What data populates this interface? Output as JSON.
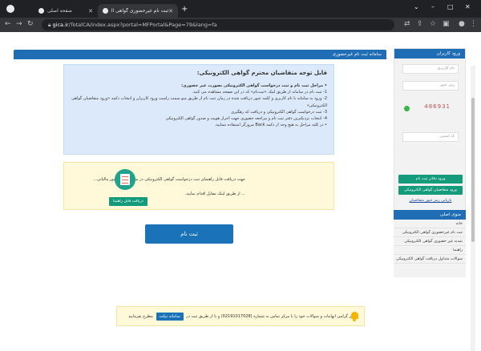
{
  "browser": {
    "tabs": [
      {
        "title": "صفحه اصلی"
      },
      {
        "title": "ثبت نام غیرحضوری گواهی الکترونیک"
      }
    ],
    "new_tab": "+",
    "url_host": "gica.ir",
    "url_path": "/TotalCA/index.aspx?portal=MFPortal&Page=79&lang=fa",
    "window_controls": {
      "minimize": "–",
      "maximize": "□",
      "close": "✕"
    }
  },
  "main": {
    "panel_title": "سامانه ثبت نام غیرحضوری",
    "notice": {
      "heading": "قابل توجه متقاضیان محترم گواهی الکترونیکی:",
      "lines": [
        "• مراحل ثبت نام و ثبت درخواست گواهی الکترونیکی بصورت غیر حضوری:",
        "1- ثبت نام در سامانه از طریق لینک «ثبت‌نام» که در این صفحه مشاهده می کنید.",
        "2- ورود به سامانه با نام کاربری و کلمه عبور دریافت شده در زمان ثبت نام از طریق منو سمت راست ورود کاربران و انتخاب دکمه «ورود متقاضیان گواهی الکترونیکی»",
        "3- ثبت درخواست گواهی الکترونیکی و دریافت کد رهگیری",
        "4- انتخاب نزدیکترین دفتر ثبت نام و مراجعه حضوری جهت احراز هویت و صدور گواهی الکترونیکی",
        "• در کلیه مراحل به هیچ وجه از دکمه Back مرورگر استفاده ننمایید."
      ]
    },
    "download": {
      "text1": "جهت دریافت فایل راهنمای ثبت درخواست گواهی الکترونیکی در سامانه ستاد امور مالیاتی...",
      "text2": "... از طریق لینک مقابل اقدام نمایید.",
      "button": "دریافت فایل راهنما"
    },
    "signup_button": "ثبت نام",
    "footer": {
      "text_before": "کاربر گرامی ابهامات و سوالات خود را با مرکز تماس به شماره (02191017028) و یا از طریق ثبت در",
      "system": "سامانه تیکت",
      "text_after": "مطرح بفرمایید"
    }
  },
  "sidebar": {
    "login_title": "ورود کاربران",
    "username_placeholder": "نام کاربری",
    "password_placeholder": "رمز عبور",
    "captcha_value": "486931",
    "captcha_placeholder": "کد امنیتی",
    "login_button": "ورود دفاتر ثبت نام",
    "applicant_button": "ورود متقاضیان گواهی الکترونیکی",
    "forgot_link": "بازیابی رمز عبور متقاضیان",
    "menu_title": "منوی اصلی",
    "menu_items": [
      "خانه",
      "ثبت نام غیرحضوری گواهی الکترونیکی",
      "تمدید غیر حضوری گواهی الکترونیکی",
      "راهنما",
      "سوالات متداول دریافت گواهی الکترونیکی"
    ]
  }
}
